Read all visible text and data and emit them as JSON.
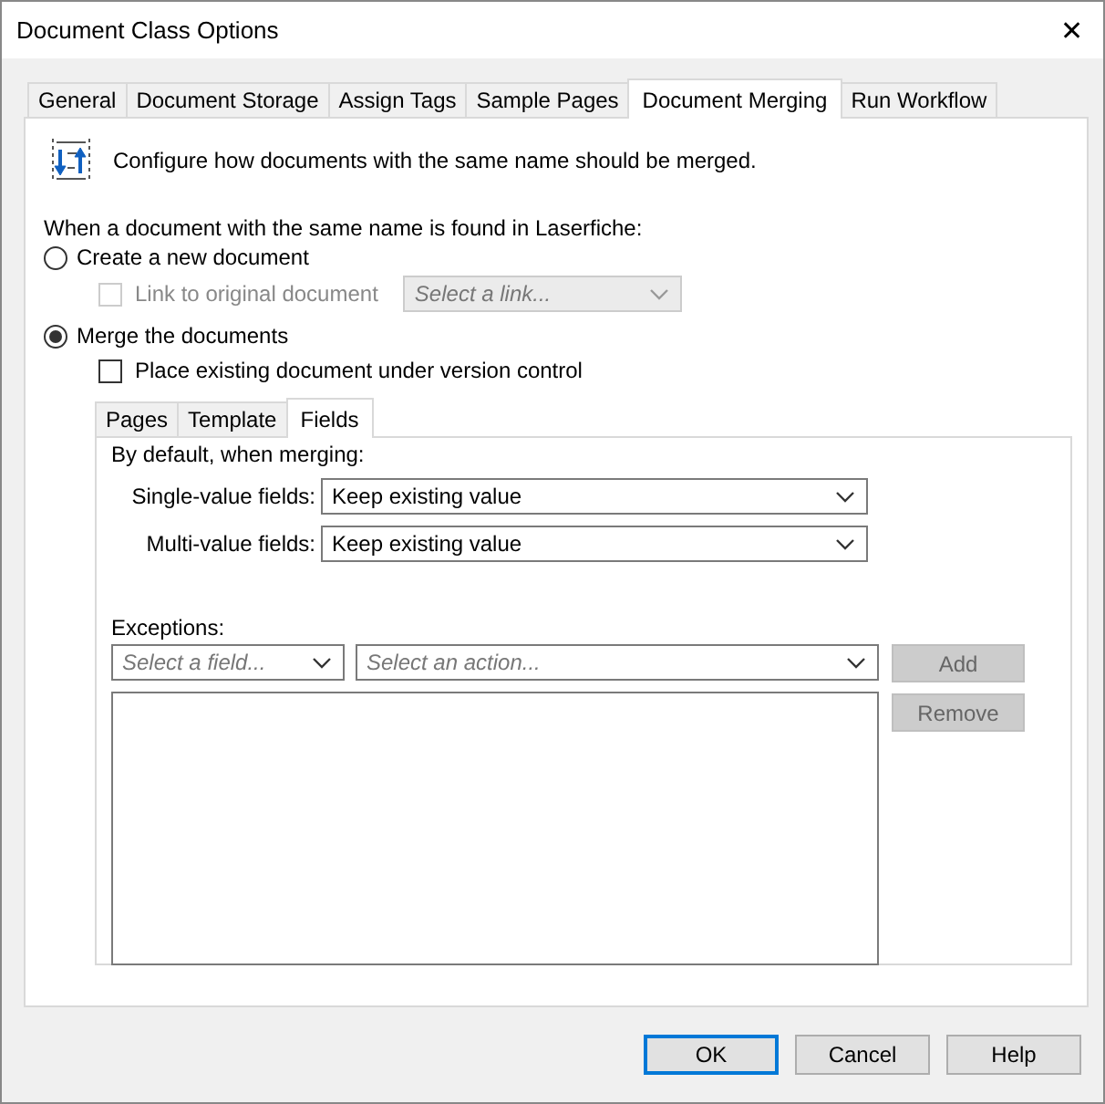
{
  "window": {
    "title": "Document Class Options",
    "close": "✕"
  },
  "tabs": [
    {
      "label": "General",
      "selected": false
    },
    {
      "label": "Document Storage",
      "selected": false
    },
    {
      "label": "Assign Tags",
      "selected": false
    },
    {
      "label": "Sample Pages",
      "selected": false
    },
    {
      "label": "Document Merging",
      "selected": true
    },
    {
      "label": "Run Workflow",
      "selected": false
    }
  ],
  "description": "Configure how documents with the same name should be merged.",
  "prompt": "When a document with the same name is found in Laserfiche:",
  "create_option": {
    "label": "Create a new document",
    "selected": false
  },
  "link_checkbox": {
    "label": "Link to original document",
    "checked": false,
    "disabled": true
  },
  "link_select": {
    "placeholder": "Select a link...",
    "disabled": true
  },
  "merge_option": {
    "label": "Merge the documents",
    "selected": true
  },
  "version_checkbox": {
    "label": "Place existing document under version control",
    "checked": false,
    "disabled": false
  },
  "inner_tabs": [
    {
      "label": "Pages",
      "selected": false
    },
    {
      "label": "Template",
      "selected": false
    },
    {
      "label": "Fields",
      "selected": true
    }
  ],
  "default_label": "By default, when merging:",
  "settings": [
    {
      "label": "Single-value fields:",
      "value": "Keep existing value"
    },
    {
      "label": "Multi-value fields:",
      "value": "Keep existing value"
    }
  ],
  "exceptions_label": "Exceptions:",
  "field_select": {
    "placeholder": "Select a field..."
  },
  "action_select": {
    "placeholder": "Select an action..."
  },
  "side_buttons": [
    {
      "label": "Add",
      "disabled": true
    },
    {
      "label": "Remove",
      "disabled": true
    }
  ],
  "footer_buttons": [
    {
      "label": "OK",
      "default": true
    },
    {
      "label": "Cancel",
      "default": false
    },
    {
      "label": "Help",
      "default": false
    }
  ]
}
